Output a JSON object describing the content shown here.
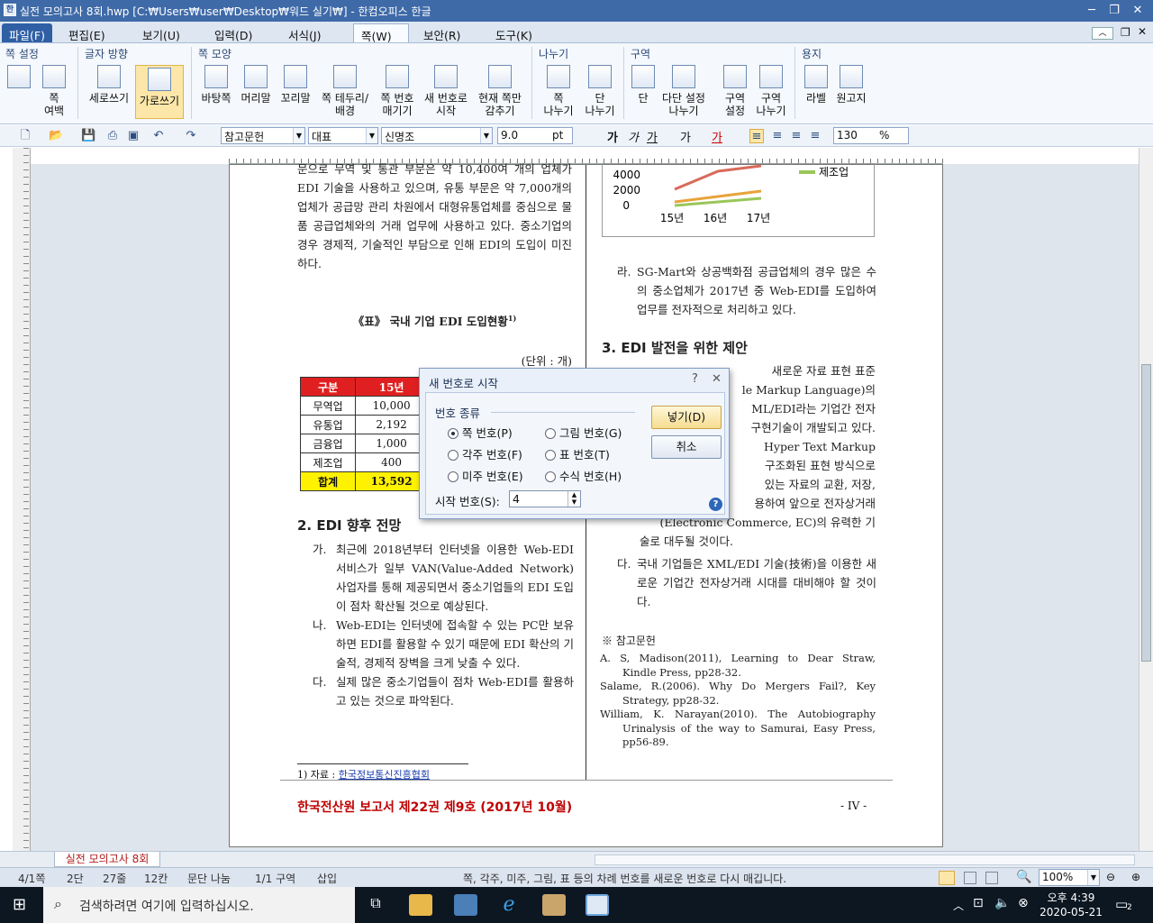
{
  "window": {
    "title": "실전 모의고사 8회.hwp [C:₩Users₩user₩Desktop₩워드 실기₩] - 한컴오피스 한글",
    "app_icon": "한"
  },
  "menu": {
    "items": [
      "파일(F)",
      "편집(E)",
      "보기(U)",
      "입력(D)",
      "서식(J)",
      "쪽(W)",
      "보안(R)",
      "도구(K)"
    ]
  },
  "ribbon": {
    "groups": {
      "page_setup": "쪽 설정",
      "text_dir": "글자 방향",
      "page_shape": "쪽 모양",
      "split": "나누기",
      "section": "구역",
      "paper": "용지"
    },
    "buttons": {
      "margin": "쪽\n여백",
      "vertical": "세로쓰기",
      "horizontal": "가로쓰기",
      "background": "바탕쪽",
      "header": "머리말",
      "footer": "꼬리말",
      "border": "쪽 테두리/\n배경",
      "page_num": "쪽 번호\n매기기",
      "new_num": "새 번호로\n시작",
      "hide": "현재 쪽만\n감추기",
      "page_break": "쪽\n나누기",
      "col_break": "단\n나누기",
      "col": "단",
      "multi_col": "다단 설정\n나누기",
      "sec_set": "구역\n설정",
      "sec_break": "구역\n나누기",
      "label": "라벨",
      "manuscript": "원고지"
    }
  },
  "toolbar": {
    "style": "참고문헌",
    "font_kind": "대표",
    "font": "신명조",
    "size": "9.0",
    "unit": "pt",
    "line_spacing": "130",
    "percent": "%"
  },
  "doc": {
    "left_top_para": "문으로 무역 및 통관 부문은 약 10,400여 개의 업체가 EDI 기술을 사용하고 있으며, 유통 부문은 약 7,000개의 업체가 공급망 관리 차원에서 대형유통업체를 중심으로 물품 공급업체와의 거래 업무에 사용하고 있다. 중소기업의 경우 경제적, 기술적인 부담으로 인해 EDI의 도입이 미진하다.",
    "table_title": "《표》 국내 기업 EDI 도입현황",
    "table_title_sup": "1)",
    "unit": "(단위 : 개)",
    "table": {
      "headers": [
        "구분",
        "15년"
      ],
      "rows": [
        [
          "무역업",
          "10,000"
        ],
        [
          "유통업",
          "2,192"
        ],
        [
          "금융업",
          "1,000"
        ],
        [
          "제조업",
          "400"
        ]
      ],
      "total": [
        "합계",
        "13,592"
      ]
    },
    "sec2_title": "2. EDI 향후 전망",
    "items2": [
      {
        "mark": "가.",
        "text": "최근에 2018년부터 인터넷을 이용한 Web-EDI 서비스가 일부 VAN(Value-Added Network) 사업자를 통해 제공되면서 중소기업들의 EDI 도입이 점차 확산될 것으로 예상된다."
      },
      {
        "mark": "나.",
        "text": "Web-EDI는 인터넷에 접속할 수 있는 PC만 보유하면 EDI를 활용할 수 있기 때문에 EDI 확산의 기술적, 경제적 장벽을 크게 낮출 수 있다."
      },
      {
        "mark": "다.",
        "text": "실제 많은 중소기업들이 점차 Web-EDI를 활용하고 있는 것으로 파악된다."
      }
    ],
    "footnote": "1) 자료 : ",
    "footnote_link": "한국정보통신진흥협회",
    "footer_title": "한국전산원 보고서 제22권 제9호 (2017년 10월)",
    "footer_page": "- IV -",
    "chart": {
      "y_ticks": [
        "4000",
        "2000",
        "0"
      ],
      "x_ticks": [
        "15년",
        "16년",
        "17년"
      ],
      "legend": "제조업"
    },
    "item_ra": {
      "mark": "라.",
      "text": "SG-Mart와 상공백화점 공급업체의 경우 많은 수의 중소업체가 2017년 중 Web-EDI를 도입하여 업무를 전자적으로 처리하고 있다."
    },
    "sec3_title": "3. EDI 발전을 위한 제안",
    "right_fragments": [
      "새로운 자료 표현 표준",
      "le Markup Language)의",
      "ML/EDI라는 기업간 전자",
      "구현기술이 개발되고 있다.",
      "Hyper Text Markup",
      "구조화된 표현 방식으로",
      "있는 자료의 교환, 저장,",
      "용하여 앞으로 전자상거래",
      "(Electronic Commerce, EC)의 유력한 기",
      "술로 대두될 것이다."
    ],
    "item_da": {
      "mark": "다.",
      "text": "국내 기업들은 XML/EDI 기술(技術)을 이용한 새로운 기업간 전자상거래 시대를 대비해야 할 것이다."
    },
    "refs_title": "※ 참고문헌",
    "refs": [
      "A. S, Madison(2011), Learning to Dear Straw, Kindle Press, pp28-32.",
      "Salame, R.(2006). Why Do Mergers Fail?, Key Strategy, pp28-32.",
      "William, K. Narayan(2010). The Autobiography Urinalysis of the way to Samurai, Easy Press, pp56-89."
    ]
  },
  "dialog": {
    "title": "새 번호로 시작",
    "help": "?",
    "close": "✕",
    "group_label": "번호 종류",
    "options": [
      "쪽 번호(P)",
      "그림 번호(G)",
      "각주 번호(F)",
      "표 번호(T)",
      "미주 번호(E)",
      "수식 번호(H)"
    ],
    "selected": "쪽 번호(P)",
    "start_label": "시작 번호(S):",
    "start_value": "4",
    "ok": "넣기(D)",
    "cancel": "취소"
  },
  "tabbar": {
    "doc_tab": "실전 모의고사 8회"
  },
  "status": {
    "page": "4/1쪽",
    "cols": "2단",
    "line": "27줄",
    "col": "12칸",
    "para": "문단 나눔",
    "section": "1/1 구역",
    "mode": "삽입",
    "hint": "쪽, 각주, 미주, 그림, 표 등의 차례 번호를 새로운 번호로 다시 매깁니다.",
    "zoom": "100%"
  },
  "taskbar": {
    "search_placeholder": "검색하려면 여기에 입력하십시오.",
    "time": "오후 4:39",
    "date": "2020-05-21",
    "notif_count": "2"
  }
}
